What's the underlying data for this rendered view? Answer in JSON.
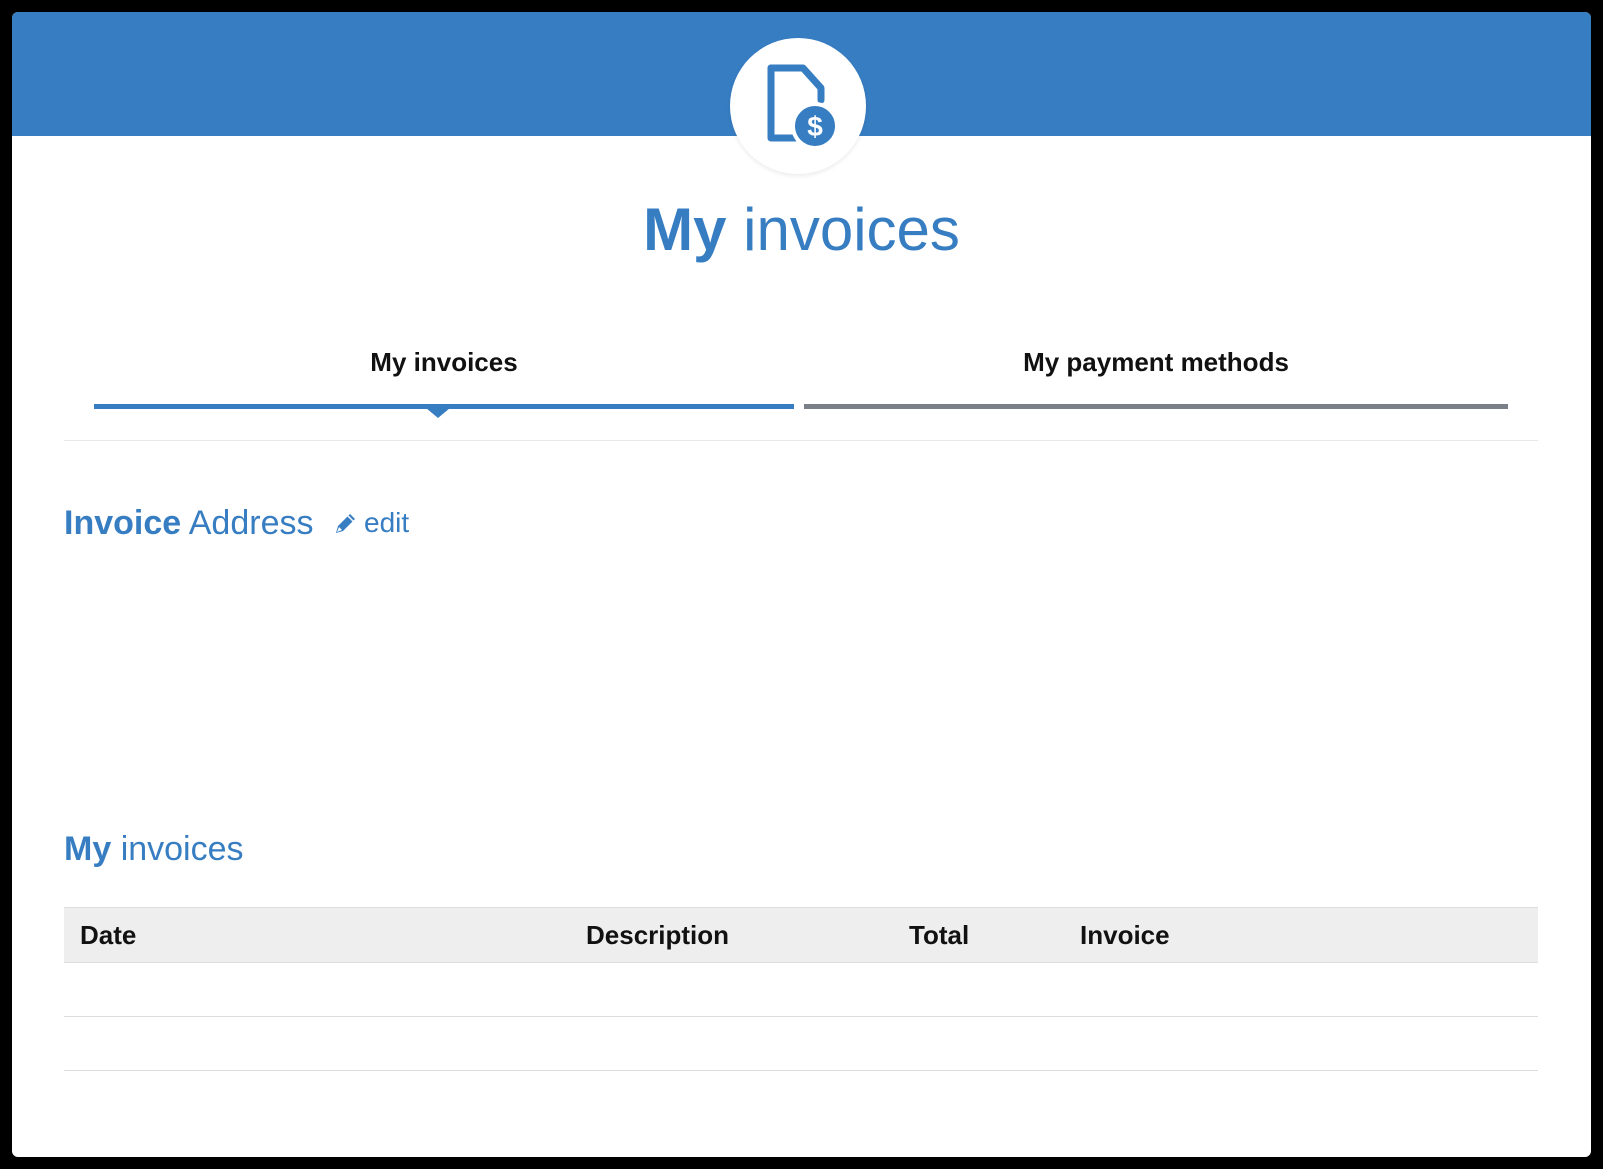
{
  "page": {
    "title_strong": "My",
    "title_light": "invoices",
    "badge_icon": "invoice-dollar-icon",
    "accent_color": "#377dc2"
  },
  "tabs": [
    {
      "label": "My invoices",
      "active": true
    },
    {
      "label": "My payment methods",
      "active": false
    }
  ],
  "address_section": {
    "title_strong": "Invoice",
    "title_light": "Address",
    "edit_label": "edit",
    "edit_icon": "pencil-icon"
  },
  "invoices_section": {
    "title_strong": "My",
    "title_light": "invoices",
    "columns": [
      "Date",
      "Description",
      "Total",
      "Invoice"
    ],
    "rows": []
  }
}
